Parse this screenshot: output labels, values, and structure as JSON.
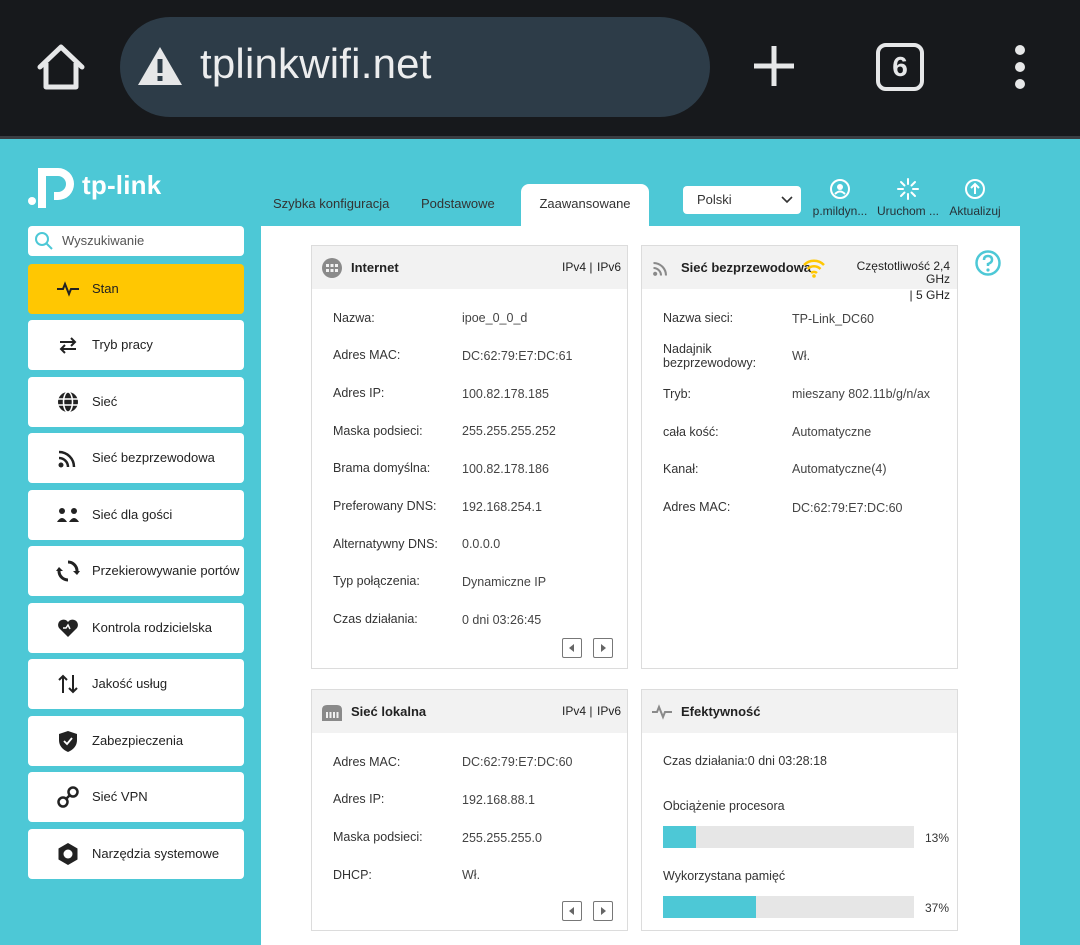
{
  "browser": {
    "url": "tplinkwifi.net",
    "tab_count": "6"
  },
  "brand": {
    "logo_text": "tp-link"
  },
  "top_tabs": [
    {
      "label": "Szybka konfiguracja"
    },
    {
      "label": "Podstawowe"
    },
    {
      "label": "Zaawansowane"
    }
  ],
  "language": {
    "selected": "Polski"
  },
  "tools": [
    {
      "label": "p.mildyn..."
    },
    {
      "label": "Uruchom ..."
    },
    {
      "label": "Aktualizuj"
    }
  ],
  "search": {
    "placeholder": "Wyszukiwanie"
  },
  "sidebar": {
    "items": [
      {
        "label": "Stan",
        "icon": "pulse-icon"
      },
      {
        "label": "Tryb pracy",
        "icon": "swap-icon"
      },
      {
        "label": "Sieć",
        "icon": "globe-icon"
      },
      {
        "label": "Sieć bezprzewodowa",
        "icon": "wifi-icon"
      },
      {
        "label": "Sieć dla gości",
        "icon": "guests-icon"
      },
      {
        "label": "Przekierowywanie portów",
        "icon": "port-forward-icon"
      },
      {
        "label": "Kontrola rodzicielska",
        "icon": "heart-icon"
      },
      {
        "label": "Jakość usług",
        "icon": "qos-icon"
      },
      {
        "label": "Zabezpieczenia",
        "icon": "shield-icon"
      },
      {
        "label": "Sieć VPN",
        "icon": "vpn-icon"
      },
      {
        "label": "Narzędzia systemowe",
        "icon": "gear-icon"
      }
    ]
  },
  "internet": {
    "title": "Internet",
    "ipv4": "IPv4 |",
    "ipv6": "IPv6",
    "rows": [
      {
        "label": "Nazwa:",
        "value": "ipoe_0_0_d"
      },
      {
        "label": "Adres MAC:",
        "value": "DC:62:79:E7:DC:61"
      },
      {
        "label": "Adres IP:",
        "value": "100.82.178.185"
      },
      {
        "label": "Maska podsieci:",
        "value": "255.255.255.252"
      },
      {
        "label": "Brama domyślna:",
        "value": "100.82.178.186"
      },
      {
        "label": "Preferowany DNS:",
        "value": "192.168.254.1"
      },
      {
        "label": "Alternatywny DNS:",
        "value": "0.0.0.0"
      },
      {
        "label": "Typ połączenia:",
        "value": "Dynamiczne IP"
      },
      {
        "label": "Czas działania:",
        "value": "0 dni 03:26:45"
      }
    ]
  },
  "wireless": {
    "title": "Sieć bezprzewodowa",
    "freq_line1": "Częstotliwość 2,4",
    "freq_line2": "GHz",
    "freq_line3": "|  5 GHz",
    "rows": [
      {
        "label": "Nazwa sieci:",
        "value": "TP-Link_DC60"
      },
      {
        "label": "Nadajnik bezprzewodowy:",
        "label1": "Nadajnik",
        "label2": "bezprzewodowy:",
        "value": "Wł."
      },
      {
        "label": "Tryb:",
        "value": "mieszany 802.11b/g/n/ax"
      },
      {
        "label": "cała kość:",
        "value": "Automatyczne"
      },
      {
        "label": "Kanał:",
        "value": "Automatyczne(4)"
      },
      {
        "label": "Adres MAC:",
        "value": "DC:62:79:E7:DC:60"
      }
    ]
  },
  "lan": {
    "title": "Sieć lokalna",
    "ipv4": "IPv4 |",
    "ipv6": "IPv6",
    "rows": [
      {
        "label": "Adres MAC:",
        "value": "DC:62:79:E7:DC:60"
      },
      {
        "label": "Adres IP:",
        "value": "192.168.88.1"
      },
      {
        "label": "Maska podsieci:",
        "value": "255.255.255.0"
      },
      {
        "label": "DHCP:",
        "value": "Wł."
      }
    ]
  },
  "performance": {
    "title": "Efektywność",
    "uptime": "Czas działania:0 dni 03:28:18",
    "cpu_label": "Obciążenie procesora",
    "cpu_percent_text": "13%",
    "cpu_fraction": 0.13,
    "mem_label": "Wykorzystana pamięć",
    "mem_percent_text": "37%",
    "mem_fraction": 0.37
  },
  "colors": {
    "accent": "#4dc8d6",
    "active_nav": "#ffc702",
    "wifi": "#ffc702"
  }
}
